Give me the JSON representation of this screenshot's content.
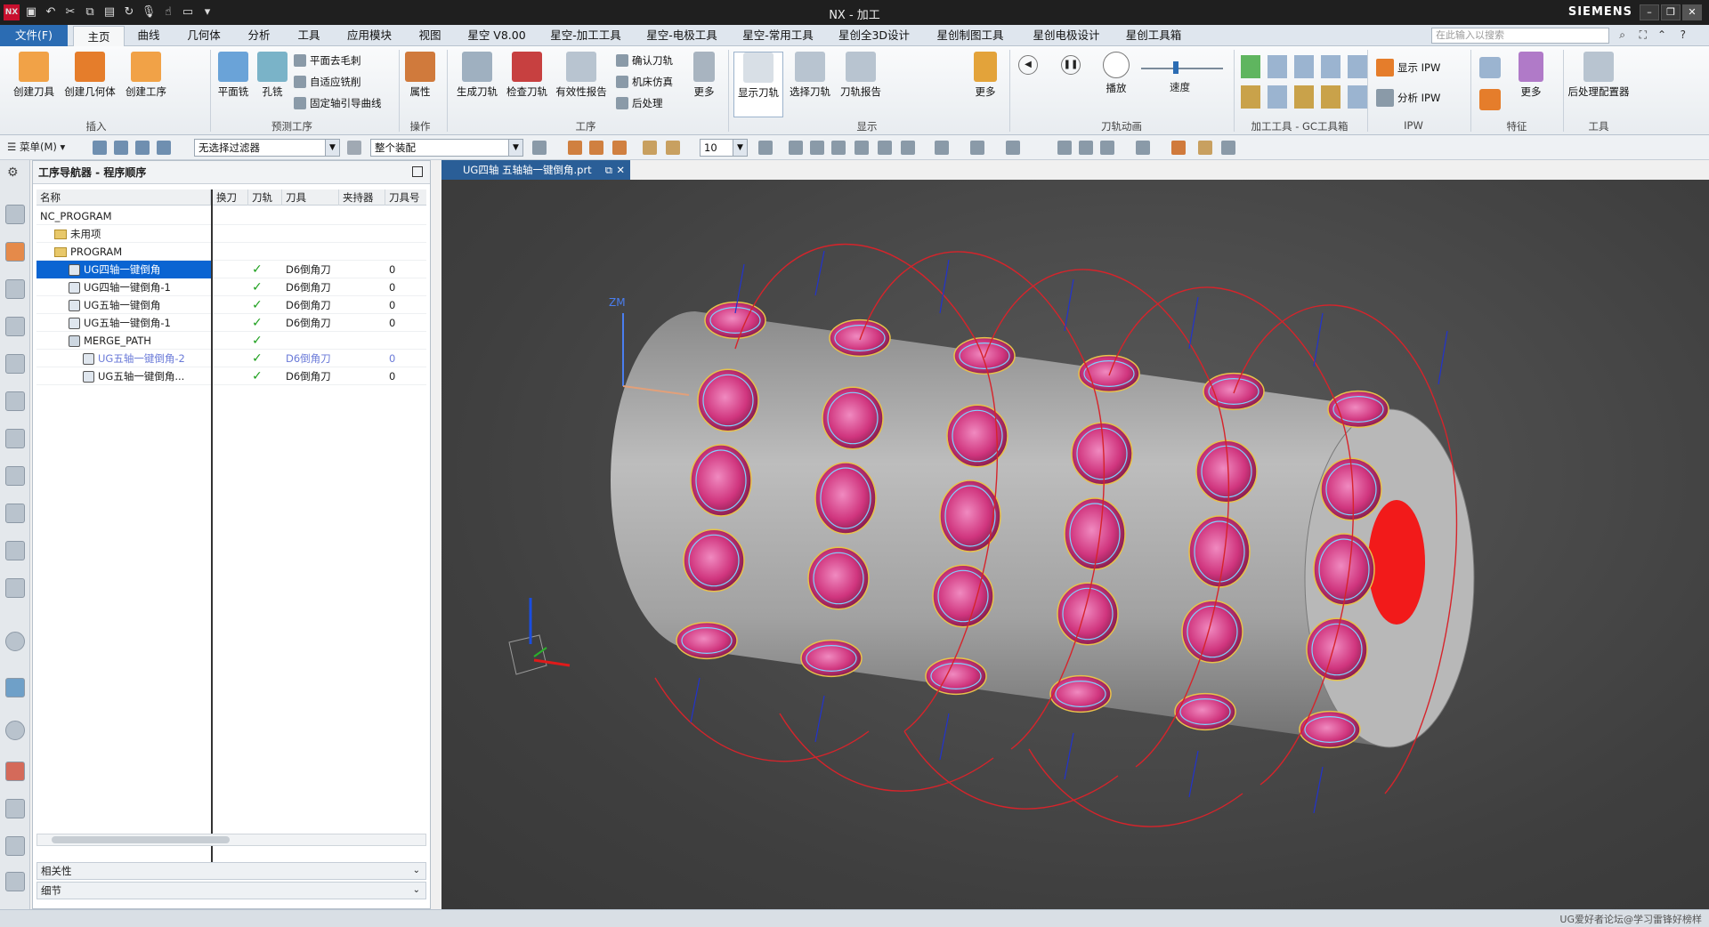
{
  "window": {
    "title": "NX - 加工",
    "brand": "SIEMENS",
    "nx_logo": "NX"
  },
  "menu": {
    "file": "文件(F)",
    "tabs": [
      "主页",
      "曲线",
      "几何体",
      "分析",
      "工具",
      "应用模块",
      "视图",
      "星空 V8.00",
      "星空-加工工具",
      "星空-电极工具",
      "星空-常用工具",
      "星创全3D设计",
      "星创制图工具",
      "星创电极设计",
      "星创工具箱"
    ],
    "active": "主页",
    "search_placeholder": "在此输入以搜索"
  },
  "ribbon": {
    "insert": {
      "label": "插入",
      "buttons": [
        "创建刀具",
        "创建几何体",
        "创建工序"
      ]
    },
    "pre_ops": {
      "label": "预测工序",
      "buttons": [
        "平面铣",
        "孔铣"
      ],
      "small": [
        "平面去毛刺",
        "自适应铣削",
        "固定轴引导曲线"
      ]
    },
    "operation": {
      "label": "操作",
      "buttons": [
        "属性"
      ]
    },
    "process": {
      "label": "工序",
      "buttons": [
        "生成刀轨",
        "检查刀轨",
        "有效性报告",
        "更多"
      ],
      "small": [
        "确认刀轨",
        "机床仿真",
        "后处理"
      ]
    },
    "display": {
      "label": "显示",
      "buttons": [
        "显示刀轨",
        "选择刀轨",
        "刀轨报告",
        "更多"
      ]
    },
    "anim": {
      "label": "刀轨动画",
      "buttons": [
        "播放"
      ],
      "speed": "速度"
    },
    "tools_gc": {
      "label": "加工工具 - GC工具箱"
    },
    "ipw": {
      "label": "IPW",
      "small": [
        "显示 IPW",
        "分析 IPW"
      ]
    },
    "feature": {
      "label": "特征",
      "buttons": [
        "更多"
      ]
    },
    "tools": {
      "label": "工具",
      "buttons": [
        "后处理配置器"
      ]
    }
  },
  "toolbar2": {
    "menu_label": "菜单(M)",
    "filter": "无选择过滤器",
    "assembly": "整个装配",
    "count": "10"
  },
  "navigator": {
    "title": "工序导航器 - 程序顺序",
    "columns": [
      "名称",
      "换刀",
      "刀轨",
      "刀具",
      "夹持器",
      "刀具号"
    ],
    "rows": [
      {
        "name": "NC_PROGRAM",
        "indent": 0,
        "kind": "root",
        "check": "",
        "tool": "",
        "num": ""
      },
      {
        "name": "未用项",
        "indent": 1,
        "kind": "folder",
        "check": "",
        "tool": "",
        "num": ""
      },
      {
        "name": "PROGRAM",
        "indent": 1,
        "kind": "folder",
        "check": "",
        "tool": "",
        "num": ""
      },
      {
        "name": "UG四轴一键倒角",
        "indent": 2,
        "kind": "op",
        "check": "✓",
        "tool": "D6倒角刀",
        "num": "0",
        "selected": true
      },
      {
        "name": "UG四轴一键倒角-1",
        "indent": 2,
        "kind": "op",
        "check": "✓",
        "tool": "D6倒角刀",
        "num": "0"
      },
      {
        "name": "UG五轴一键倒角",
        "indent": 2,
        "kind": "op",
        "check": "✓",
        "tool": "D6倒角刀",
        "num": "0"
      },
      {
        "name": "UG五轴一键倒角-1",
        "indent": 2,
        "kind": "op",
        "check": "✓",
        "tool": "D6倒角刀",
        "num": "0"
      },
      {
        "name": "MERGE_PATH",
        "indent": 2,
        "kind": "merge",
        "check": "✓",
        "tool": "",
        "num": ""
      },
      {
        "name": "UG五轴一键倒角-2",
        "indent": 3,
        "kind": "op",
        "check": "✓",
        "tool": "D6倒角刀",
        "num": "0",
        "dim": true
      },
      {
        "name": "UG五轴一键倒角...",
        "indent": 3,
        "kind": "op",
        "check": "✓",
        "tool": "D6倒角刀",
        "num": "0"
      }
    ],
    "accordion": [
      "相关性",
      "细节"
    ]
  },
  "document_tab": "UG四轴 五轴轴一键倒角.prt",
  "viewport": {
    "axis_label": "ZM"
  },
  "status": "UG爱好者论坛@学习雷锋好榜样",
  "colors": {
    "part": "#a8a8a8",
    "pocket": "#d9418a",
    "toolpath": "#d6242b",
    "tool_axis": "#2233cc",
    "bore": "#ff1a1a"
  }
}
